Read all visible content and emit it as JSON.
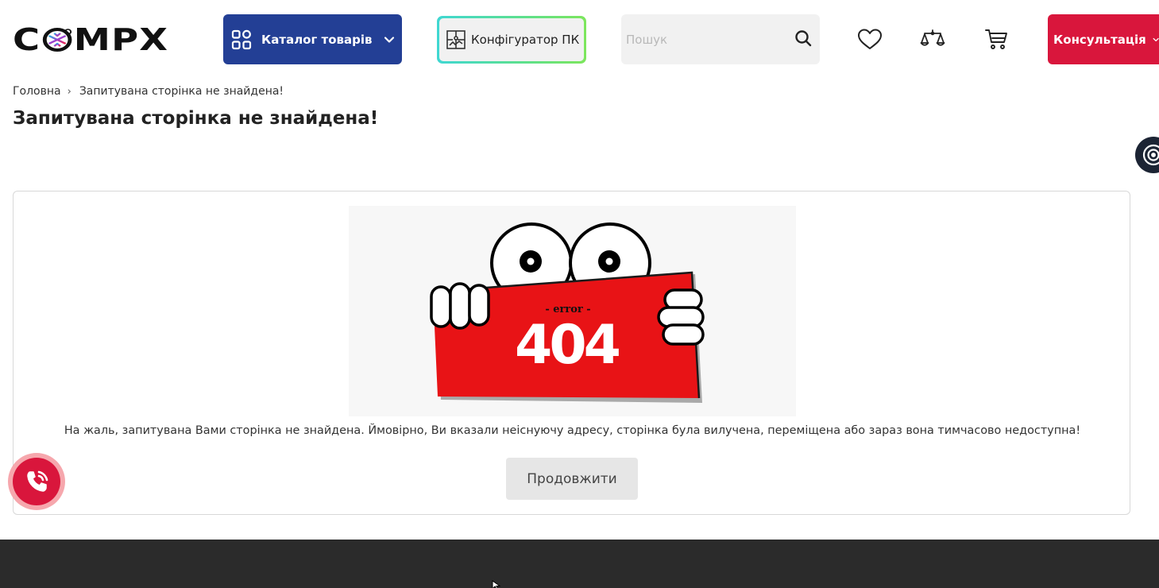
{
  "brand": {
    "logo_left": "C",
    "logo_right": "MPX"
  },
  "header": {
    "catalog_label": "Каталог товарів",
    "configurator_label": "Конфігуратор ПК",
    "search_placeholder": "Пошук",
    "consult_label": "Консультація"
  },
  "icons": {
    "wishlist": "heart-icon",
    "compare": "scales-icon",
    "cart": "cart-icon",
    "phone": "phone-icon",
    "accessibility": "accessibility-icon"
  },
  "breadcrumb": {
    "home": "Головна",
    "separator": "›",
    "current": "Запитувана сторінка не знайдена!"
  },
  "page": {
    "title": "Запитувана сторінка не знайдена!",
    "illustration_small": "- error -",
    "illustration_code": "404",
    "message": "На жаль, запитувана Вами сторінка не знайдена. Ймовірно, Ви вказали неіснуючу адресу, сторінка була вилучена, переміщена або зараз вона тимчасово недоступна!",
    "continue_label": "Продовжити"
  },
  "colors": {
    "catalog_bg": "#233f95",
    "consult_bg": "#d9163c",
    "footer_bg": "#2b2b2b",
    "sign_red": "#e81316"
  }
}
